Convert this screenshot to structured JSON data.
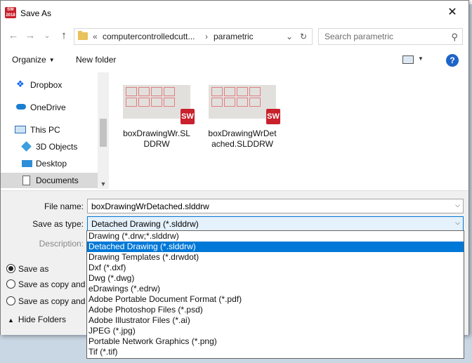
{
  "window": {
    "title": "Save As",
    "close_symbol": "✕"
  },
  "nav": {
    "back": "←",
    "forward": "→",
    "recent": "⌄",
    "up": "↑",
    "path": [
      "computercontrolledcutt...",
      "parametric"
    ],
    "path_prefix": "«",
    "separator": "›",
    "search_placeholder": "Search parametric"
  },
  "toolbar": {
    "organize": "Organize",
    "new_folder": "New folder"
  },
  "sidebar": {
    "items": [
      {
        "label": "Dropbox",
        "icon": "dropbox-icon"
      },
      {
        "label": "OneDrive",
        "icon": "onedrive-icon"
      },
      {
        "label": "This PC",
        "icon": "pc-icon"
      },
      {
        "label": "3D Objects",
        "icon": "3d-objects-icon"
      },
      {
        "label": "Desktop",
        "icon": "desktop-icon"
      },
      {
        "label": "Documents",
        "icon": "documents-icon",
        "selected": true
      }
    ]
  },
  "files": [
    {
      "name": "boxDrawingWr.SLDDRW"
    },
    {
      "name": "boxDrawingWrDetached.SLDDRW"
    }
  ],
  "form": {
    "file_name_label": "File name:",
    "file_name_value": "boxDrawingWrDetached.slddrw",
    "save_type_label": "Save as type:",
    "save_type_value": "Detached Drawing (*.slddrw)",
    "description_label": "Description:"
  },
  "radios": [
    {
      "label": "Save as",
      "checked": true
    },
    {
      "label": "Save as copy and c",
      "checked": false
    },
    {
      "label": "Save as copy and o",
      "checked": false
    }
  ],
  "hide_folders": "Hide Folders",
  "type_options": [
    "Drawing (*.drw;*.slddrw)",
    "Detached Drawing (*.slddrw)",
    "Drawing Templates (*.drwdot)",
    "Dxf (*.dxf)",
    "Dwg (*.dwg)",
    "eDrawings (*.edrw)",
    "Adobe Portable Document Format (*.pdf)",
    "Adobe Photoshop Files (*.psd)",
    "Adobe Illustrator Files (*.ai)",
    "JPEG (*.jpg)",
    "Portable Network Graphics (*.png)",
    "Tif (*.tif)"
  ],
  "selected_type_index": 1,
  "colors": {
    "accent": "#0078d7",
    "solidworks_red": "#c8202c"
  }
}
